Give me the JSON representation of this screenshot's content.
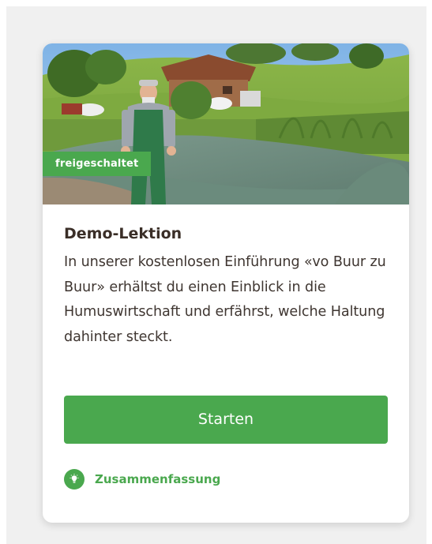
{
  "card": {
    "image": {
      "alt": "",
      "badge": "freigeschaltet"
    },
    "title": "Demo-Lektion",
    "description": "In unserer kostenlosen Einführung «vo Buur zu Buur» erhältst du einen Einblick in die Humuswirtschaft und erfährst, welche Haltung dahinter steckt.",
    "primary_button": "Starten",
    "summary_link": {
      "label": "Zusammenfassung",
      "icon": "lightbulb-icon"
    }
  },
  "colors": {
    "accent": "#4aa84e",
    "title_text": "#3a2e27",
    "body_text": "#3f3631",
    "page_background": "#f0f0f0",
    "card_background": "#ffffff"
  }
}
